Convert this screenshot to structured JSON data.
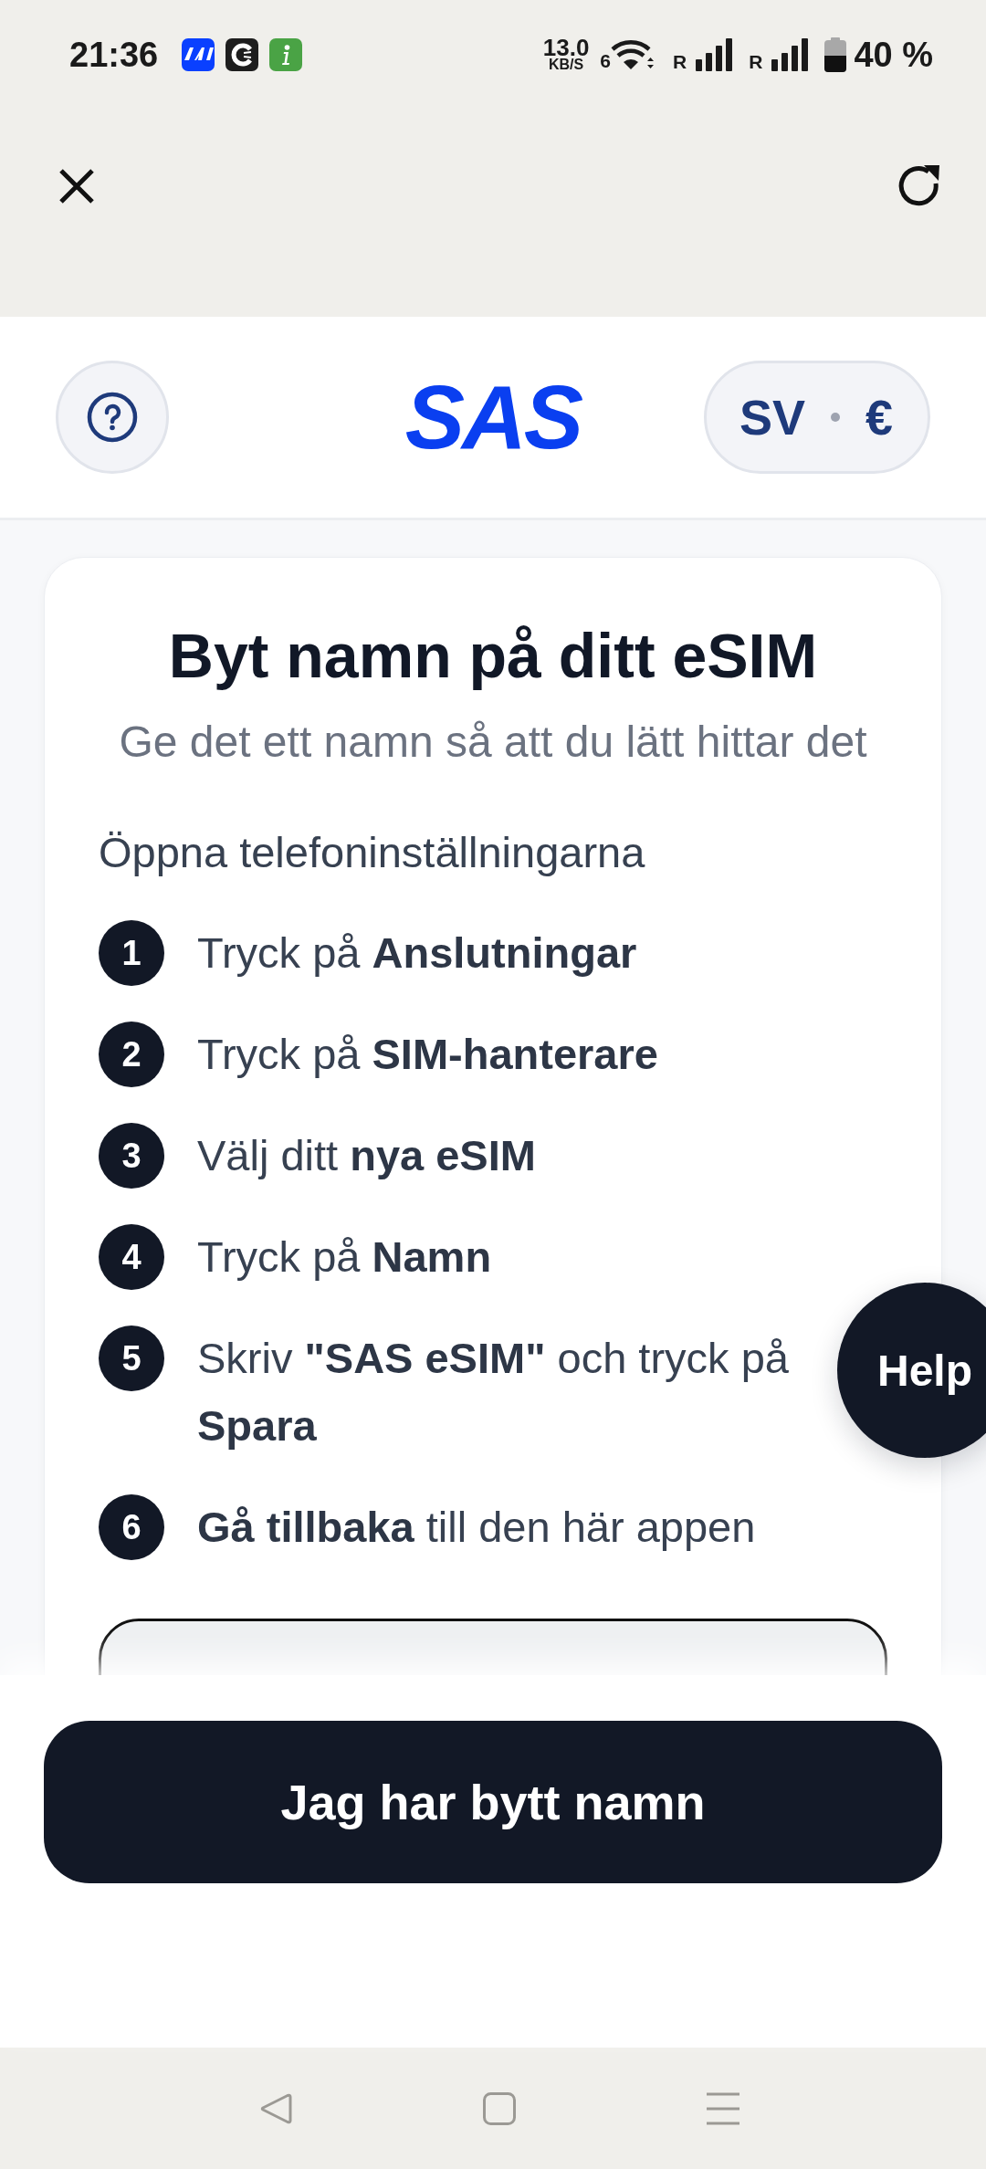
{
  "status_bar": {
    "time": "21:36",
    "network_speed": "13.0",
    "network_speed_unit": "KB/S",
    "wifi_standard": "6",
    "sims": [
      {
        "roaming": "R"
      },
      {
        "roaming": "R"
      }
    ],
    "battery_percent": "40 %"
  },
  "header": {
    "logo": "SAS",
    "language": "SV",
    "currency": "€"
  },
  "card": {
    "title": "Byt namn på ditt eSIM",
    "subtitle": "Ge det ett namn så att du lätt hittar det",
    "intro": "Öppna telefoninställningarna",
    "steps": [
      {
        "number": "1",
        "text": "Tryck på **Anslutningar**"
      },
      {
        "number": "2",
        "text": "Tryck på **SIM-hanterare**"
      },
      {
        "number": "3",
        "text": "Välj ditt **nya eSIM**"
      },
      {
        "number": "4",
        "text": "Tryck på **Namn**"
      },
      {
        "number": "5",
        "text": "Skriv **\"SAS eSIM\"** och tryck på **Spara**"
      },
      {
        "number": "6",
        "text": "**Gå tillbaka** till den här appen"
      }
    ]
  },
  "help_button": {
    "label": "Help"
  },
  "primary_button": {
    "label": "Jag har bytt namn"
  }
}
